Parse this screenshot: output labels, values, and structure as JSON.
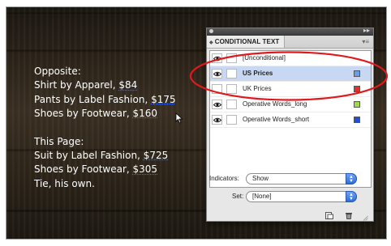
{
  "document": {
    "lines": [
      {
        "text": "Opposite:",
        "price": ""
      },
      {
        "text": "Shirt by Apparel, ",
        "price": "$84"
      },
      {
        "text": "Pants by Label Fashion, ",
        "price": "$175"
      },
      {
        "text": "Shoes by Footwear, ",
        "price": "$160"
      },
      {
        "text": "",
        "price": ""
      },
      {
        "text": "This Page:",
        "price": ""
      },
      {
        "text": "Suit by Label Fashion, ",
        "price": "$725"
      },
      {
        "text": "Shoes by Footwear, ",
        "price": "$305"
      },
      {
        "text": "Tie, his own.",
        "price": ""
      }
    ]
  },
  "panel": {
    "title": "CONDITIONAL TEXT",
    "conditions": [
      {
        "name": "[Unconditional]",
        "visible": true,
        "selected": false,
        "swatch": ""
      },
      {
        "name": "US Prices",
        "visible": true,
        "selected": true,
        "swatch": "#6a9ee8"
      },
      {
        "name": "UK Prices",
        "visible": false,
        "selected": false,
        "swatch": "#e0322a"
      },
      {
        "name": "Operative Words_long",
        "visible": true,
        "selected": false,
        "swatch": "#9fd84a"
      },
      {
        "name": "Operative Words_short",
        "visible": true,
        "selected": false,
        "swatch": "#1f4fd8"
      }
    ],
    "indicators_label": "Indicators:",
    "indicators_value": "Show",
    "set_label": "Set:",
    "set_value": "[None]"
  },
  "colors": {
    "annotation": "#e0191c",
    "select_arrow": "#2d6fd8"
  },
  "icons": {
    "new_condition": "new-item-icon",
    "delete_condition": "trash-icon",
    "panel_menu": "panel-menu-icon"
  }
}
